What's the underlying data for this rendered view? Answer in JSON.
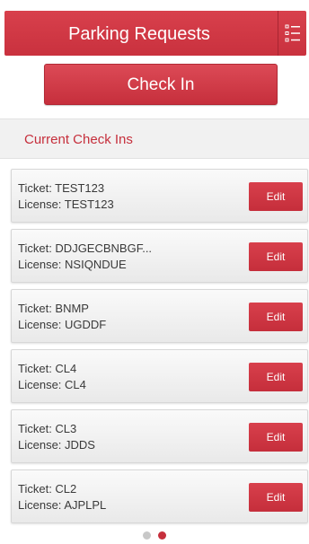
{
  "header": {
    "title": "Parking Requests",
    "menu_icon": "list-menu-icon"
  },
  "checkin_button": {
    "label": "Check In"
  },
  "section": {
    "title": "Current Check Ins"
  },
  "checkins": [
    {
      "ticket": "Ticket: TEST123",
      "license": "License: TEST123",
      "edit_label": "Edit"
    },
    {
      "ticket": "Ticket: DDJGECBNBGF...",
      "license": "License: NSIQNDUE",
      "edit_label": "Edit"
    },
    {
      "ticket": "Ticket: BNMP",
      "license": "License: UGDDF",
      "edit_label": "Edit"
    },
    {
      "ticket": "Ticket: CL4",
      "license": "License: CL4",
      "edit_label": "Edit"
    },
    {
      "ticket": "Ticket: CL3",
      "license": "License: JDDS",
      "edit_label": "Edit"
    },
    {
      "ticket": "Ticket: CL2",
      "license": "License: AJPLPL",
      "edit_label": "Edit"
    }
  ],
  "pagination": {
    "pages": 2,
    "current": 2
  },
  "colors": {
    "accent": "#c62f3c",
    "header": "#d03845",
    "section_bg": "#f1f1f1"
  }
}
